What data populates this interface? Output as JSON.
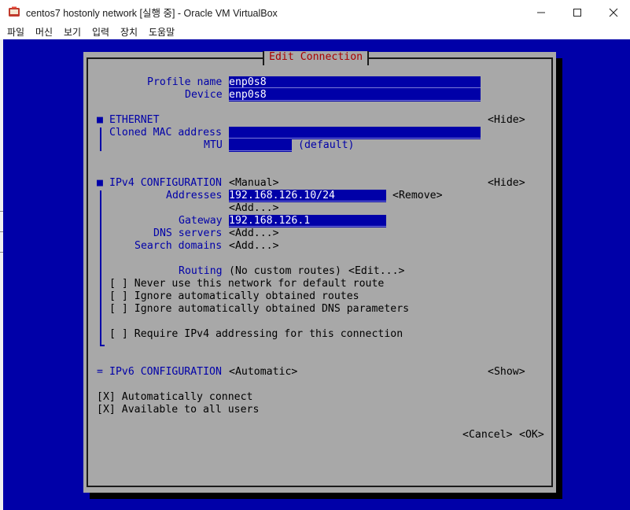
{
  "window": {
    "title": "centos7 hostonly network [실행 중] - Oracle VM VirtualBox",
    "menu": [
      "파일",
      "머신",
      "보기",
      "입력",
      "장치",
      "도움말"
    ]
  },
  "dialog": {
    "title": "Edit Connection",
    "profile_name_label": "Profile name",
    "profile_name_value": "enp0s8",
    "device_label": "Device",
    "device_value": "enp0s8",
    "ethernet": {
      "bullet": "■",
      "header": "ETHERNET",
      "toggle": "<Hide>",
      "cloned_mac_label": "Cloned MAC address",
      "cloned_mac_value": "",
      "mtu_label": "MTU",
      "mtu_value": "",
      "mtu_hint": "(default)"
    },
    "ipv4": {
      "bullet": "■",
      "header": "IPv4 CONFIGURATION",
      "mode": "<Manual>",
      "toggle": "<Hide>",
      "addresses_label": "Addresses",
      "address_value": "192.168.126.10/24",
      "remove_button": "<Remove>",
      "add_address_button": "<Add...>",
      "gateway_label": "Gateway",
      "gateway_value": "192.168.126.1",
      "dns_label": "DNS servers",
      "dns_add": "<Add...>",
      "search_label": "Search domains",
      "search_add": "<Add...>",
      "routing_label": "Routing",
      "routing_value": "(No custom routes)",
      "routing_edit": "<Edit...>",
      "never_default": "[ ] Never use this network for default route",
      "ignore_routes": "[ ] Ignore automatically obtained routes",
      "ignore_dns": "[ ] Ignore automatically obtained DNS parameters",
      "require_ipv4": "[ ] Require IPv4 addressing for this connection"
    },
    "ipv6": {
      "bullet": "=",
      "header": "IPv6 CONFIGURATION",
      "mode": "<Automatic>",
      "toggle": "<Show>"
    },
    "auto_connect": "[X] Automatically connect",
    "all_users": "[X] Available to all users",
    "cancel_button": "<Cancel>",
    "ok_button": "<OK>"
  }
}
